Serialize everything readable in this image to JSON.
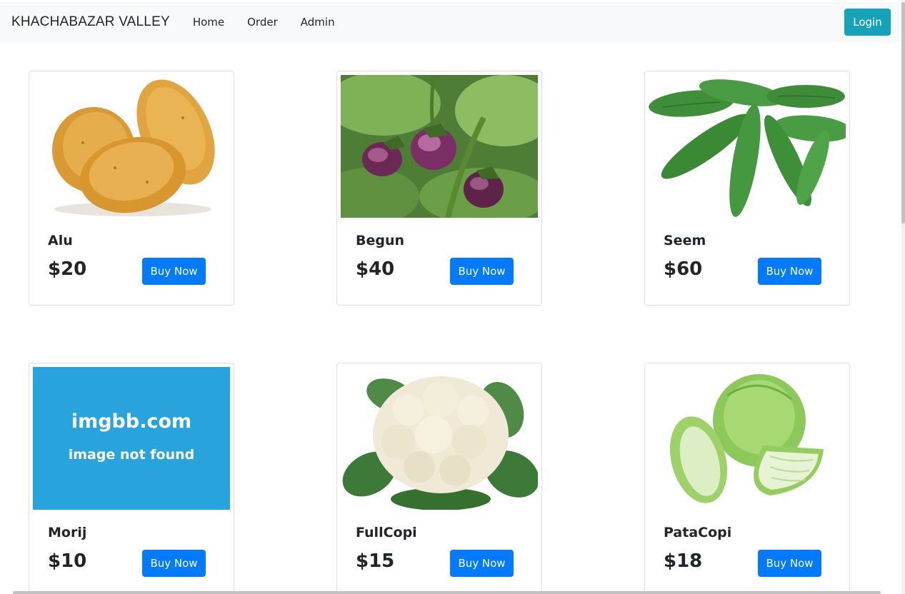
{
  "nav": {
    "brand": "KHACHABAZAR VALLEY",
    "links": [
      "Home",
      "Order",
      "Admin"
    ],
    "login_label": "Login"
  },
  "products": [
    {
      "name": "Alu",
      "price": "$20",
      "button": "Buy Now",
      "image_icon": "potato-image"
    },
    {
      "name": "Begun",
      "price": "$40",
      "button": "Buy Now",
      "image_icon": "eggplant-image"
    },
    {
      "name": "Seem",
      "price": "$60",
      "button": "Buy Now",
      "image_icon": "beans-image"
    },
    {
      "name": "Morij",
      "price": "$10",
      "button": "Buy Now",
      "image_icon": "image-not-found-placeholder",
      "image_text": {
        "site": "imgbb.com",
        "message": "image not found"
      }
    },
    {
      "name": "FullCopi",
      "price": "$15",
      "button": "Buy Now",
      "image_icon": "cauliflower-image"
    },
    {
      "name": "PataCopi",
      "price": "$18",
      "button": "Buy Now",
      "image_icon": "cabbage-image"
    }
  ],
  "colors": {
    "navbar_bg": "#f8f9fa",
    "login_btn": "#17a2b8",
    "buy_btn": "#007bff",
    "placeholder_bg": "#29a3dc"
  }
}
